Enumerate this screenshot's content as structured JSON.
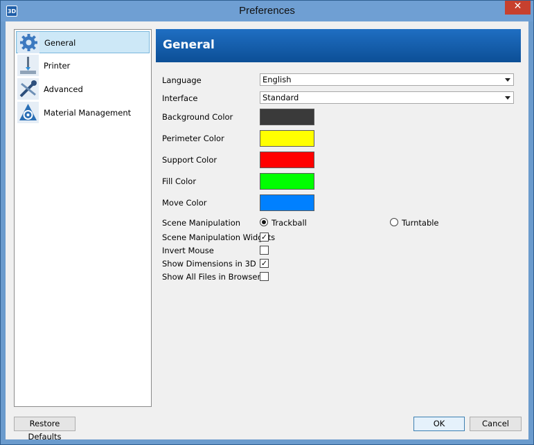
{
  "window": {
    "title": "Preferences",
    "app_icon_text": "3D",
    "close_glyph": "✕"
  },
  "sidebar": {
    "items": [
      {
        "label": "General",
        "icon": "gear-icon",
        "selected": true
      },
      {
        "label": "Printer",
        "icon": "printer-icon",
        "selected": false
      },
      {
        "label": "Advanced",
        "icon": "tools-icon",
        "selected": false
      },
      {
        "label": "Material Management",
        "icon": "material-icon",
        "selected": false
      }
    ]
  },
  "panel": {
    "header": "General",
    "language": {
      "label": "Language",
      "value": "English"
    },
    "interface": {
      "label": "Interface",
      "value": "Standard"
    },
    "colors": [
      {
        "label": "Background Color",
        "value": "#3a3a3a"
      },
      {
        "label": "Perimeter Color",
        "value": "#ffff00"
      },
      {
        "label": "Support Color",
        "value": "#ff0000"
      },
      {
        "label": "Fill Color",
        "value": "#00ff00"
      },
      {
        "label": "Move Color",
        "value": "#0080ff"
      }
    ],
    "scene_manipulation": {
      "label": "Scene Manipulation",
      "option1": "Trackball",
      "option2": "Turntable",
      "selected": "Trackball"
    },
    "checkboxes": [
      {
        "label": "Scene Manipulation Widgets",
        "checked": true
      },
      {
        "label": "Invert Mouse",
        "checked": false
      },
      {
        "label": "Show Dimensions in 3D",
        "checked": true
      },
      {
        "label": "Show All Files in Browser",
        "checked": false
      }
    ]
  },
  "footer": {
    "restore": "Restore Defaults",
    "ok": "OK",
    "cancel": "Cancel"
  }
}
